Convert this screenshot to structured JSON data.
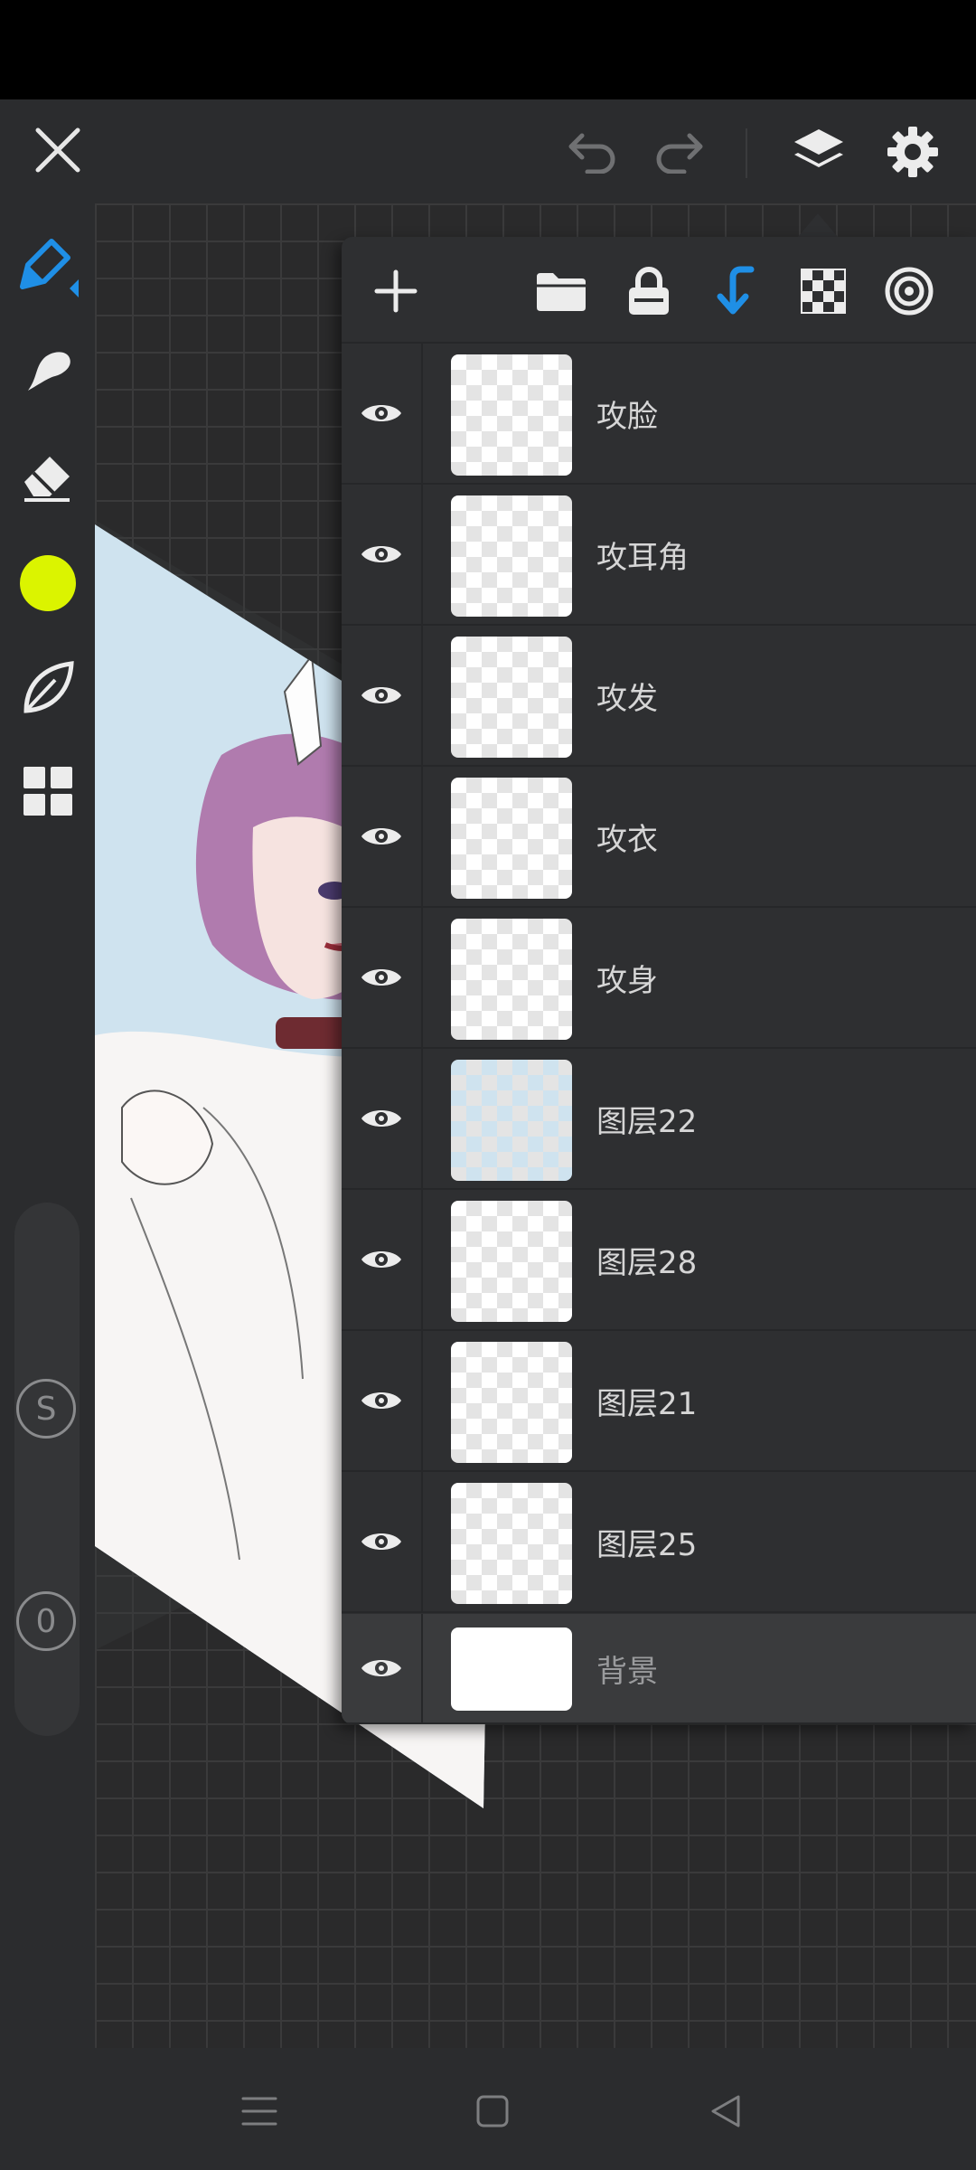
{
  "app": {
    "colors": {
      "accent": "#1f8fe6",
      "current_color": "#dbf400",
      "toolbar_bg": "#2b2c2e",
      "panel_bg": "#2e2f31"
    }
  },
  "top_toolbar": {
    "close_icon": "close-icon",
    "undo_icon": "undo-icon",
    "redo_icon": "redo-icon",
    "layers_icon": "layers-icon",
    "settings_icon": "gear-icon"
  },
  "left_toolbar": {
    "tools": [
      "brush-icon",
      "smudge-icon",
      "eraser-icon",
      "color-swatch",
      "leaf-icon",
      "grid-icon"
    ],
    "size_slider_label": "S",
    "opacity_slider_label": "0"
  },
  "layers_panel": {
    "toolbar_icons": [
      "add-icon",
      "folder-icon",
      "lock-icon",
      "clip-down-icon",
      "transparency-icon",
      "target-icon"
    ],
    "layers": [
      {
        "name": "攻脸"
      },
      {
        "name": "攻耳角"
      },
      {
        "name": "攻发"
      },
      {
        "name": "攻衣"
      },
      {
        "name": "攻身"
      },
      {
        "name": "图层22"
      },
      {
        "name": "图层28"
      },
      {
        "name": "图层21"
      },
      {
        "name": "图层25"
      }
    ],
    "background_layer": {
      "name": "背景"
    }
  },
  "nav_bar": {
    "icons": [
      "menu-icon",
      "home-icon",
      "back-icon"
    ]
  }
}
